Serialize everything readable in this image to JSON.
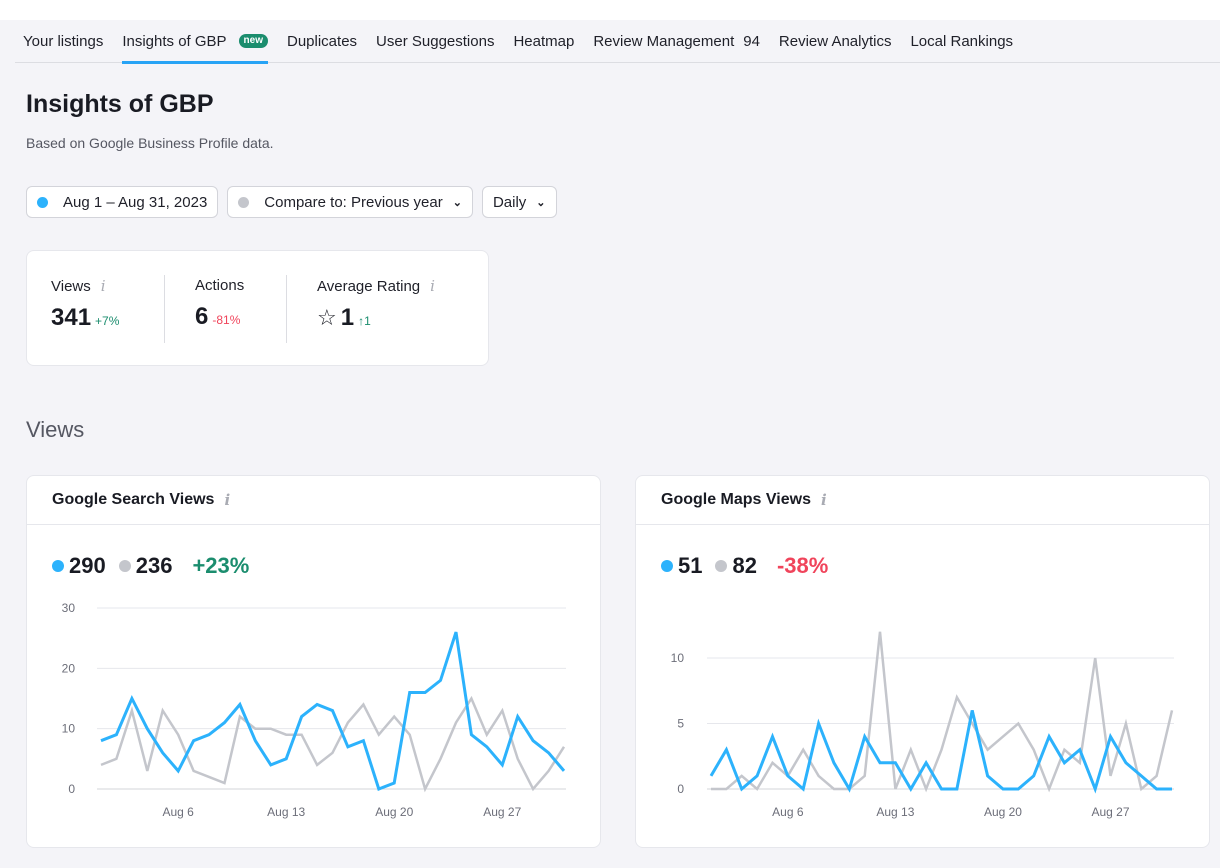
{
  "tabs": [
    {
      "label": "Your listings"
    },
    {
      "label": "Insights of GBP",
      "badge": "new",
      "active": true
    },
    {
      "label": "Duplicates"
    },
    {
      "label": "User Suggestions"
    },
    {
      "label": "Heatmap"
    },
    {
      "label": "Review Management",
      "count": "94"
    },
    {
      "label": "Review Analytics"
    },
    {
      "label": "Local Rankings"
    }
  ],
  "header": {
    "title": "Insights of GBP",
    "subtitle": "Based on Google Business Profile data."
  },
  "filters": {
    "date_range": "Aug 1 – Aug 31, 2023",
    "compare": "Compare to: Previous year",
    "granularity": "Daily"
  },
  "summary": {
    "views": {
      "label": "Views",
      "value": "341",
      "delta": "+7%"
    },
    "actions": {
      "label": "Actions",
      "value": "6",
      "delta": "-81%"
    },
    "rating": {
      "label": "Average Rating",
      "value": "1",
      "delta": "↑1"
    }
  },
  "icons": {
    "info": "i",
    "star": "☆",
    "chevron": "⌄"
  },
  "colors": {
    "current": "#2cb2fc",
    "previous": "#c4c6cc",
    "positive": "#1b8d6e",
    "negative": "#f0445b",
    "accent": "#27a3f5"
  },
  "section_title": "Views",
  "cards": {
    "search": {
      "title": "Google Search Views",
      "current": "290",
      "previous": "236",
      "delta": "+23%"
    },
    "maps": {
      "title": "Google Maps Views",
      "current": "51",
      "previous": "82",
      "delta": "-38%"
    }
  },
  "chart_data": [
    {
      "type": "line",
      "title": "Google Search Views",
      "x": [
        "Aug 1",
        "Aug 2",
        "Aug 3",
        "Aug 4",
        "Aug 5",
        "Aug 6",
        "Aug 7",
        "Aug 8",
        "Aug 9",
        "Aug 10",
        "Aug 11",
        "Aug 12",
        "Aug 13",
        "Aug 14",
        "Aug 15",
        "Aug 16",
        "Aug 17",
        "Aug 18",
        "Aug 19",
        "Aug 20",
        "Aug 21",
        "Aug 22",
        "Aug 23",
        "Aug 24",
        "Aug 25",
        "Aug 26",
        "Aug 27",
        "Aug 28",
        "Aug 29",
        "Aug 30",
        "Aug 31"
      ],
      "x_ticks": [
        "Aug 6",
        "Aug 13",
        "Aug 20",
        "Aug 27"
      ],
      "y_ticks": [
        0,
        10,
        20,
        30
      ],
      "ylim": [
        0,
        30
      ],
      "grid": true,
      "series": [
        {
          "name": "Previous year",
          "color": "#c4c6cc",
          "values": [
            4,
            5,
            13,
            3,
            13,
            9,
            3,
            2,
            1,
            12,
            10,
            10,
            9,
            9,
            4,
            6,
            11,
            14,
            9,
            12,
            9,
            0,
            5,
            11,
            15,
            9,
            13,
            5,
            0,
            3,
            7
          ]
        },
        {
          "name": "Aug 1 – Aug 31, 2023",
          "color": "#2cb2fc",
          "values": [
            8,
            9,
            15,
            10,
            6,
            3,
            8,
            9,
            11,
            14,
            8,
            4,
            5,
            12,
            14,
            13,
            7,
            8,
            0,
            1,
            16,
            16,
            18,
            26,
            9,
            7,
            4,
            12,
            8,
            6,
            3
          ]
        }
      ]
    },
    {
      "type": "line",
      "title": "Google Maps Views",
      "x": [
        "Aug 1",
        "Aug 2",
        "Aug 3",
        "Aug 4",
        "Aug 5",
        "Aug 6",
        "Aug 7",
        "Aug 8",
        "Aug 9",
        "Aug 10",
        "Aug 11",
        "Aug 12",
        "Aug 13",
        "Aug 14",
        "Aug 15",
        "Aug 16",
        "Aug 17",
        "Aug 18",
        "Aug 19",
        "Aug 20",
        "Aug 21",
        "Aug 22",
        "Aug 23",
        "Aug 24",
        "Aug 25",
        "Aug 26",
        "Aug 27",
        "Aug 28",
        "Aug 29",
        "Aug 30",
        "Aug 31"
      ],
      "x_ticks": [
        "Aug 6",
        "Aug 13",
        "Aug 20",
        "Aug 27"
      ],
      "y_ticks": [
        0,
        5,
        10
      ],
      "ylim": [
        0,
        12
      ],
      "grid": true,
      "series": [
        {
          "name": "Previous year",
          "color": "#c4c6cc",
          "values": [
            0,
            0,
            1,
            0,
            2,
            1,
            3,
            1,
            0,
            0,
            1,
            12,
            0,
            3,
            0,
            3,
            7,
            5,
            3,
            4,
            5,
            3,
            0,
            3,
            2,
            10,
            1,
            5,
            0,
            1,
            6
          ]
        },
        {
          "name": "Aug 1 – Aug 31, 2023",
          "color": "#2cb2fc",
          "values": [
            1,
            3,
            0,
            1,
            4,
            1,
            0,
            5,
            2,
            0,
            4,
            2,
            2,
            0,
            2,
            0,
            0,
            6,
            1,
            0,
            0,
            1,
            4,
            2,
            3,
            0,
            4,
            2,
            1,
            0,
            0
          ]
        }
      ]
    }
  ]
}
